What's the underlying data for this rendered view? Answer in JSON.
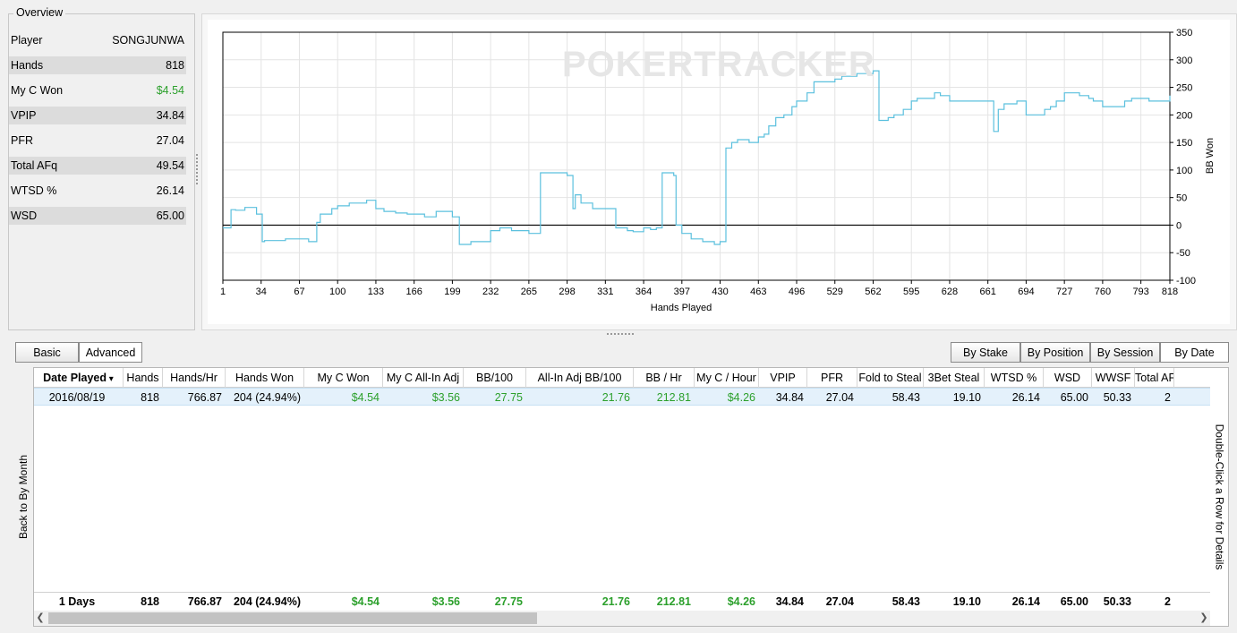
{
  "overview": {
    "legend": "Overview",
    "rows": [
      {
        "label": "Player",
        "value": "SONGJUNWA"
      },
      {
        "label": "Hands",
        "value": "818"
      },
      {
        "label": "My C Won",
        "value": "$4.54",
        "color": "#2ca02c"
      },
      {
        "label": "VPIP",
        "value": "34.84"
      },
      {
        "label": "PFR",
        "value": "27.04"
      },
      {
        "label": "Total AFq",
        "value": "49.54"
      },
      {
        "label": "WTSD %",
        "value": "26.14"
      },
      {
        "label": "WSD",
        "value": "65.00"
      }
    ]
  },
  "chart": {
    "watermark": "POKERTRACKER",
    "xlabel": "Hands Played",
    "ylabel": "BB Won",
    "line_color": "#5bc0de",
    "x_ticks": [
      "1",
      "34",
      "67",
      "100",
      "133",
      "166",
      "199",
      "232",
      "265",
      "298",
      "331",
      "364",
      "397",
      "430",
      "463",
      "496",
      "529",
      "562",
      "595",
      "628",
      "661",
      "694",
      "727",
      "760",
      "793",
      "818"
    ],
    "y_ticks": [
      "350",
      "300",
      "250",
      "200",
      "150",
      "100",
      "50",
      "0",
      "-50",
      "-100"
    ]
  },
  "chart_data": {
    "type": "line",
    "xlabel": "Hands Played",
    "ylabel": "BB Won",
    "xlim": [
      1,
      818
    ],
    "ylim": [
      -100,
      350
    ],
    "grid": true,
    "series": [
      {
        "x": [
          1,
          8,
          12,
          20,
          30,
          35,
          37,
          55,
          60,
          67,
          75,
          82,
          85,
          95,
          100,
          110,
          125,
          133,
          140,
          150,
          160,
          166,
          175,
          185,
          199,
          205,
          210,
          215,
          232,
          240,
          250,
          265,
          275,
          278,
          298,
          303,
          305,
          310,
          320,
          331,
          340,
          350,
          355,
          364,
          370,
          375,
          380,
          383,
          390,
          392,
          397,
          405,
          415,
          425,
          430,
          435,
          440,
          445,
          455,
          463,
          468,
          472,
          478,
          485,
          492,
          496,
          505,
          511,
          520,
          529,
          535,
          548,
          556,
          562,
          567,
          575,
          580,
          588,
          595,
          600,
          615,
          620,
          628,
          640,
          650,
          661,
          666,
          670,
          675,
          686,
          694,
          710,
          715,
          720,
          727,
          740,
          748,
          752,
          760,
          770,
          779,
          785,
          790,
          800,
          810,
          818
        ],
        "y": [
          -5,
          28,
          27,
          32,
          20,
          -30,
          -28,
          -25,
          -25,
          -25,
          -30,
          5,
          20,
          30,
          35,
          40,
          45,
          30,
          25,
          22,
          20,
          20,
          15,
          25,
          15,
          -35,
          -35,
          -30,
          -10,
          -5,
          -10,
          -15,
          95,
          95,
          90,
          30,
          55,
          40,
          30,
          30,
          -5,
          -10,
          -12,
          -5,
          -8,
          -5,
          95,
          95,
          90,
          0,
          -15,
          -25,
          -30,
          -35,
          -30,
          140,
          150,
          155,
          150,
          160,
          165,
          180,
          195,
          200,
          215,
          225,
          240,
          260,
          260,
          265,
          270,
          275,
          275,
          280,
          190,
          195,
          200,
          210,
          225,
          230,
          240,
          235,
          225,
          225,
          225,
          225,
          170,
          210,
          220,
          225,
          200,
          210,
          215,
          225,
          240,
          235,
          230,
          225,
          215,
          215,
          225,
          230,
          230,
          225,
          225,
          235
        ]
      }
    ]
  },
  "view_buttons": {
    "basic": "Basic",
    "advanced": "Advanced"
  },
  "group_buttons": {
    "by_stake": "By Stake",
    "by_position": "By Position",
    "by_session": "By Session",
    "by_date": "By Date"
  },
  "side_tabs": {
    "back": "Back to By Month",
    "hint": "Double-Click a Row for Details"
  },
  "table": {
    "columns": [
      "Date Played",
      "Hands",
      "Hands/Hr",
      "Hands Won",
      "My C Won",
      "My C All-In Adj",
      "BB/100",
      "All-In Adj BB/100",
      "BB / Hr",
      "My C / Hour",
      "VPIP",
      "PFR",
      "Fold to Steal",
      "3Bet Steal",
      "WTSD %",
      "WSD",
      "WWSF",
      "Total AFq"
    ],
    "rows": [
      [
        "2016/08/19",
        "818",
        "766.87",
        "204 (24.94%)",
        "$4.54",
        "$3.56",
        "27.75",
        "21.76",
        "212.81",
        "$4.26",
        "34.84",
        "27.04",
        "58.43",
        "19.10",
        "26.14",
        "65.00",
        "50.33",
        "2"
      ]
    ],
    "totals": [
      "1 Days",
      "818",
      "766.87",
      "204 (24.94%)",
      "$4.54",
      "$3.56",
      "27.75",
      "21.76",
      "212.81",
      "$4.26",
      "34.84",
      "27.04",
      "58.43",
      "19.10",
      "26.14",
      "65.00",
      "50.33",
      "2"
    ]
  }
}
